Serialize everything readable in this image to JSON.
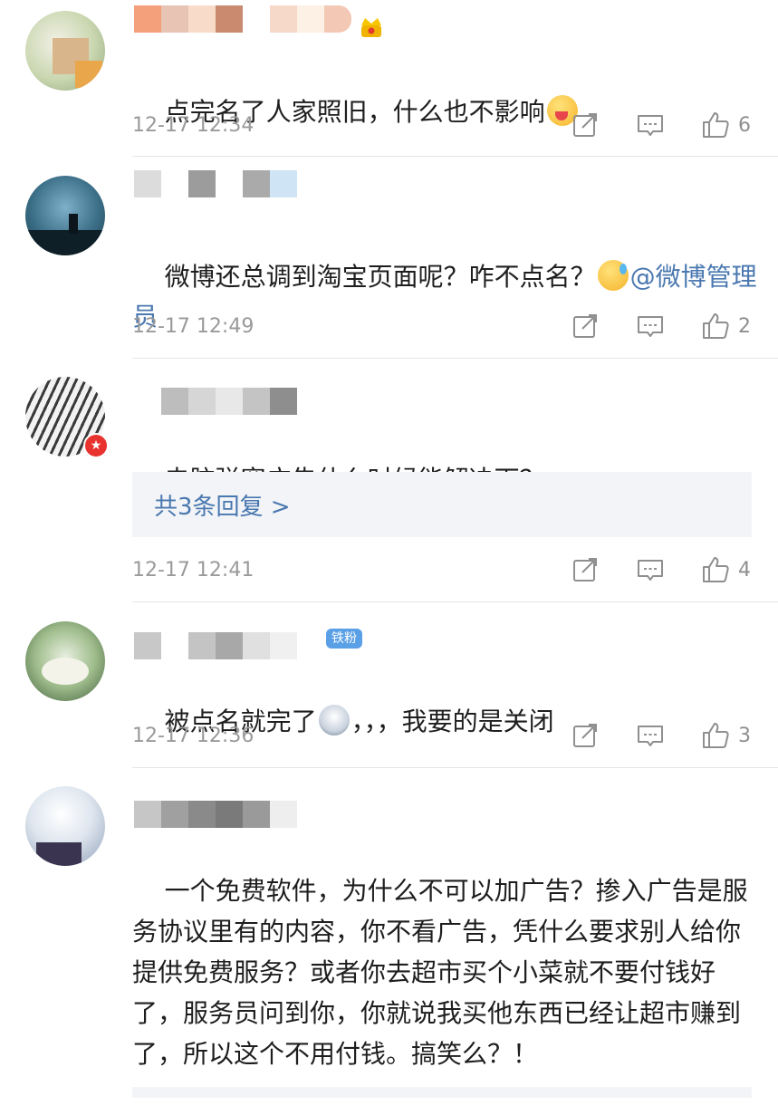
{
  "comments": [
    {
      "text": "点完名了人家照旧，什么也不影响",
      "time": "12-17 12:34",
      "likes": "6"
    },
    {
      "text": "微博还总调到淘宝页面呢？咋不点名？",
      "mention": "@微博管理员",
      "time": "12-17 12:49",
      "likes": "2"
    },
    {
      "text": "电脑弹窗广告什么时候能解决下？",
      "reply_link": "共3条回复 >",
      "time": "12-17 12:41",
      "likes": "4"
    },
    {
      "text_before": "被点名就完了",
      "text_after": "，，，我要的是关闭",
      "badge": "铁粉",
      "time": "12-17 12:36",
      "likes": "3"
    },
    {
      "text": "一个免费软件，为什么不可以加广告？掺入广告是服务协议里有的内容，你不看广告，凭什么要求别人给你提供免费服务？或者你去超市买个小菜就不要付钱好了，服务员问到你，你就说我买他东西已经让超市赚到了，所以这个不用付钱。搞笑么？！"
    }
  ],
  "icons": {
    "share": "share-icon",
    "comment": "comment-icon",
    "like": "thumbs-up-icon"
  },
  "colors": {
    "link": "#4a78b0",
    "meta": "#9a9a9a",
    "reply_bg": "#f2f4f7"
  }
}
